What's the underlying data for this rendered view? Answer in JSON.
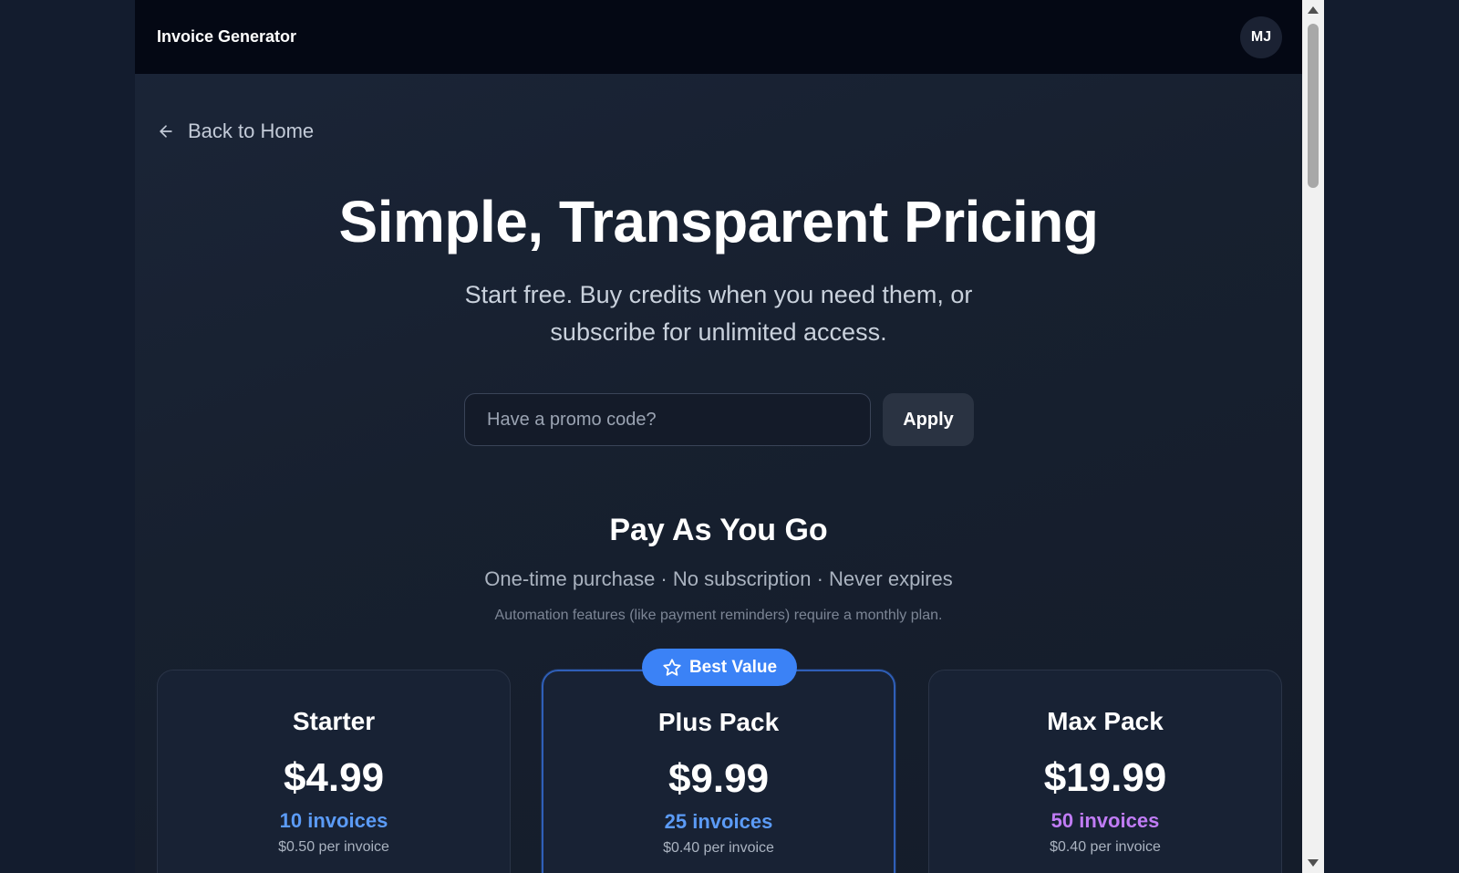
{
  "header": {
    "brand": "Invoice Generator",
    "avatar_initials": "MJ"
  },
  "nav": {
    "back_label": "Back to Home"
  },
  "hero": {
    "title": "Simple, Transparent Pricing",
    "subtitle": "Start free. Buy credits when you need them, or subscribe for unlimited access."
  },
  "promo": {
    "placeholder": "Have a promo code?",
    "value": "",
    "apply_label": "Apply"
  },
  "section": {
    "title": "Pay As You Go",
    "subtitle": "One-time purchase · No subscription · Never expires",
    "note": "Automation features (like payment reminders) require a monthly plan."
  },
  "badge": {
    "label": "Best Value",
    "color": "#3b82f6"
  },
  "plans": [
    {
      "name": "Starter",
      "price": "$4.99",
      "count": "10 invoices",
      "per": "$0.50 per invoice",
      "count_color": "#5b9bf6"
    },
    {
      "name": "Plus Pack",
      "price": "$9.99",
      "count": "25 invoices",
      "per": "$0.40 per invoice",
      "count_color": "#5b9bf6"
    },
    {
      "name": "Max Pack",
      "price": "$19.99",
      "count": "50 invoices",
      "per": "$0.40 per invoice",
      "count_color": "#c07cf5"
    }
  ],
  "icons": {
    "back": "arrow-left-icon",
    "badge": "star-icon"
  }
}
